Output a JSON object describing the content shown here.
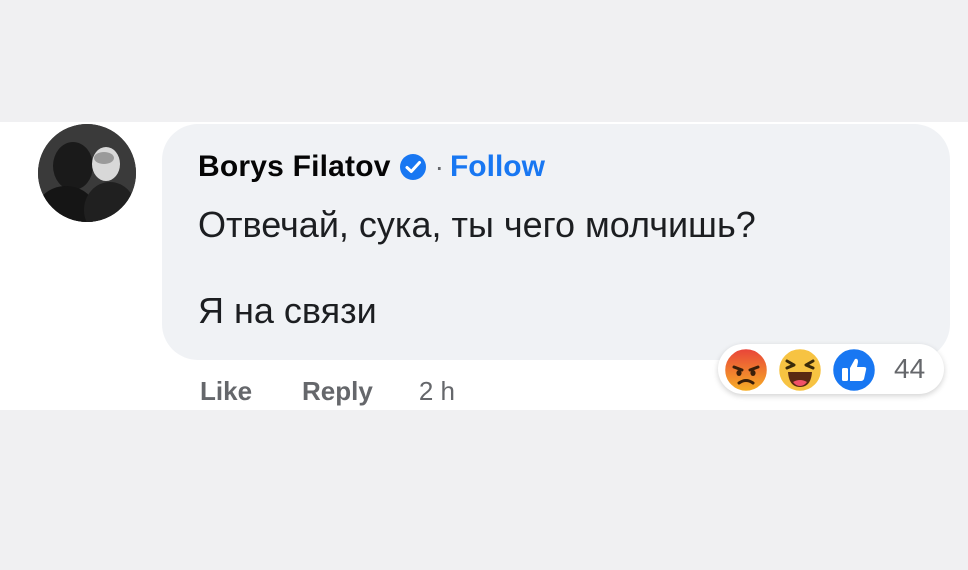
{
  "comment": {
    "author": "Borys Filatov",
    "separator": "·",
    "follow_label": "Follow",
    "lines": [
      "Отвечай, сука, ты чего молчишь?",
      "Я на связи"
    ],
    "actions": {
      "like": "Like",
      "reply": "Reply",
      "time": "2 h"
    },
    "reactions": {
      "icons": [
        "angry-icon",
        "haha-icon",
        "like-icon"
      ],
      "count": "44"
    }
  },
  "colors": {
    "link_blue": "#1877f2",
    "bubble_bg": "#f0f2f5",
    "muted_text": "#65676b",
    "angry": "#f26a1e",
    "haha": "#f7c342"
  }
}
